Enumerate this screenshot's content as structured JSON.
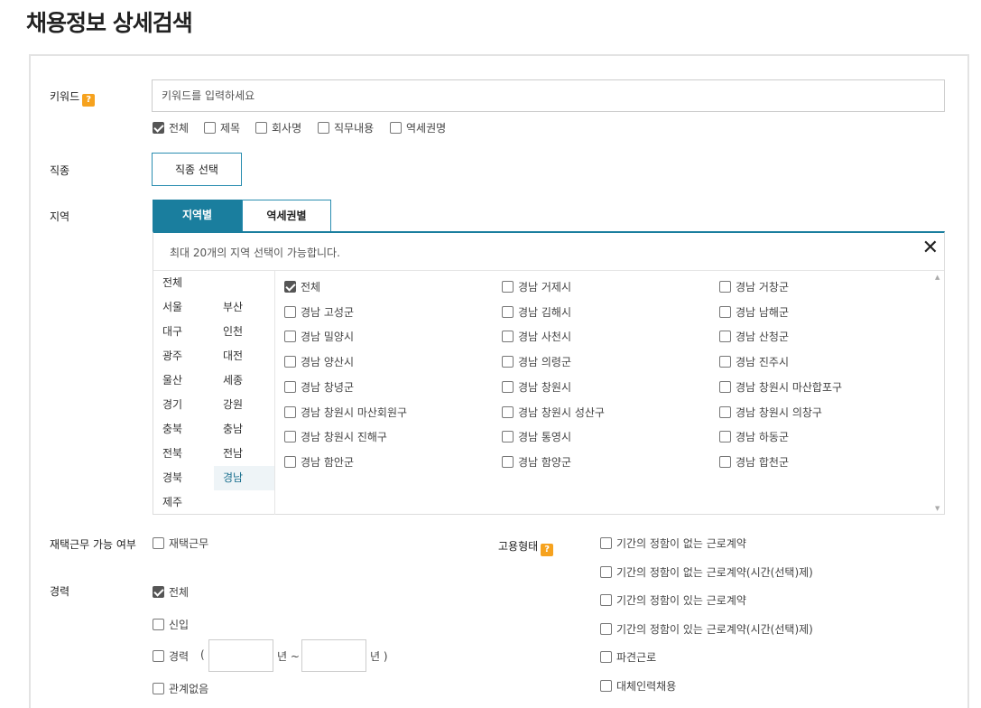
{
  "page_title": "채용정보 상세검색",
  "keyword": {
    "label": "키워드",
    "help_icon": "?",
    "placeholder": "키워드를 입력하세요",
    "scopes": [
      {
        "label": "전체",
        "checked": true
      },
      {
        "label": "제목",
        "checked": false
      },
      {
        "label": "회사명",
        "checked": false
      },
      {
        "label": "직무내용",
        "checked": false
      },
      {
        "label": "역세권명",
        "checked": false
      }
    ]
  },
  "job_type": {
    "label": "직종",
    "button": "직종 선택"
  },
  "region": {
    "label": "지역",
    "tabs": [
      {
        "label": "지역별",
        "active": true
      },
      {
        "label": "역세권별",
        "active": false
      }
    ],
    "note": "최대 20개의 지역 선택이 가능합니다.",
    "close_icon": "✕",
    "sido_all": "전체",
    "sido": [
      "서울",
      "부산",
      "대구",
      "인천",
      "광주",
      "대전",
      "울산",
      "세종",
      "경기",
      "강원",
      "충북",
      "충남",
      "전북",
      "전남",
      "경북",
      "경남",
      "제주"
    ],
    "selected_sido": "경남",
    "sigungu": [
      {
        "label": "전체",
        "checked": true
      },
      {
        "label": "경남 거제시",
        "checked": false
      },
      {
        "label": "경남 거창군",
        "checked": false
      },
      {
        "label": "경남 고성군",
        "checked": false
      },
      {
        "label": "경남 김해시",
        "checked": false
      },
      {
        "label": "경남 남해군",
        "checked": false
      },
      {
        "label": "경남 밀양시",
        "checked": false
      },
      {
        "label": "경남 사천시",
        "checked": false
      },
      {
        "label": "경남 산청군",
        "checked": false
      },
      {
        "label": "경남 양산시",
        "checked": false
      },
      {
        "label": "경남 의령군",
        "checked": false
      },
      {
        "label": "경남 진주시",
        "checked": false
      },
      {
        "label": "경남 창녕군",
        "checked": false
      },
      {
        "label": "경남 창원시",
        "checked": false
      },
      {
        "label": "경남 창원시 마산합포구",
        "checked": false
      },
      {
        "label": "경남 창원시 마산회원구",
        "checked": false
      },
      {
        "label": "경남 창원시 성산구",
        "checked": false
      },
      {
        "label": "경남 창원시 의창구",
        "checked": false
      },
      {
        "label": "경남 창원시 진해구",
        "checked": false
      },
      {
        "label": "경남 통영시",
        "checked": false
      },
      {
        "label": "경남 하동군",
        "checked": false
      },
      {
        "label": "경남 함안군",
        "checked": false
      },
      {
        "label": "경남 함양군",
        "checked": false
      },
      {
        "label": "경남 합천군",
        "checked": false
      }
    ]
  },
  "telework": {
    "label": "재택근무 가능 여부",
    "option": "재택근무",
    "checked": false
  },
  "career": {
    "label": "경력",
    "all": "전체",
    "new": "신입",
    "exp": "경력",
    "paren_open": "(",
    "year_from": "년 ~",
    "year_to": "년 )",
    "any": "관계없음",
    "all_checked": true
  },
  "employment": {
    "label": "고용형태",
    "help_icon": "?",
    "options": [
      "기간의 정함이 없는 근로계약",
      "기간의 정함이 없는 근로계약(시간(선택)제)",
      "기간의 정함이 있는 근로계약",
      "기간의 정함이 있는 근로계약(시간(선택)제)",
      "파견근로",
      "대체인력채용"
    ]
  }
}
